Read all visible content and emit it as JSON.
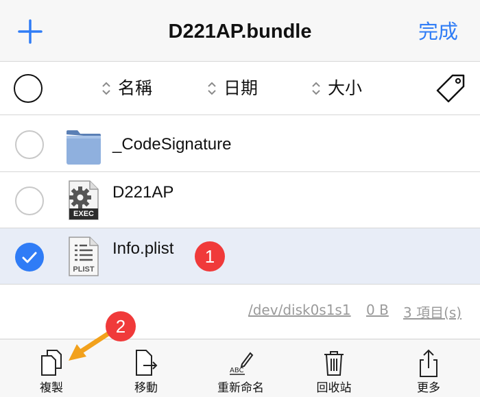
{
  "header": {
    "title": "D221AP.bundle",
    "done_label": "完成",
    "add_icon": "plus-icon"
  },
  "sortbar": {
    "name_label": "名稱",
    "date_label": "日期",
    "size_label": "大小",
    "tag_icon": "tag-icon"
  },
  "files": [
    {
      "name": "_CodeSignature",
      "type": "folder",
      "selected": false
    },
    {
      "name": "D221AP",
      "type": "exec",
      "icon_text": "EXEC",
      "selected": false
    },
    {
      "name": "Info.plist",
      "type": "plist",
      "icon_text": "PLIST",
      "selected": true
    }
  ],
  "footer": {
    "path": "/dev/disk0s1s1",
    "size": "0 B",
    "count": "3 項目(s)"
  },
  "toolbar": {
    "copy_label": "複製",
    "move_label": "移動",
    "rename_label": "重新命名",
    "trash_label": "回收站",
    "more_label": "更多"
  },
  "annotations": {
    "badge1": "1",
    "badge2": "2"
  },
  "colors": {
    "accent": "#2f7cf6",
    "selected_row": "#e8edf7",
    "badge": "#f03a3a",
    "arrow": "#f2a11c"
  }
}
